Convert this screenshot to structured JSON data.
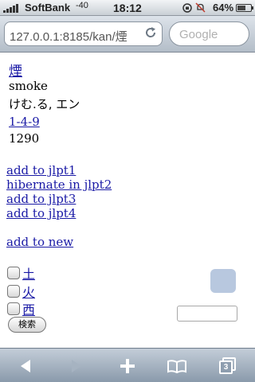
{
  "status_bar": {
    "carrier": "SoftBank",
    "rssi": "-40",
    "time": "18:12",
    "battery_percent": "64%",
    "battery_level": 0.64,
    "icons": [
      "signal-bars-icon",
      "lock-rotation-icon",
      "alarm-off-icon"
    ]
  },
  "address_bar": {
    "url": "127.0.0.1:8185/kan/煙",
    "search_placeholder": "Google"
  },
  "kanji": {
    "character": "煙",
    "meaning": "smoke",
    "readings": "けむ.る, エン",
    "code": "1-4-9",
    "number": "1290"
  },
  "actions": [
    "add to jlpt1",
    "hibernate in jlpt2",
    "add to jlpt3",
    "add to jlpt4"
  ],
  "add_to_new": "add to new",
  "radicals": [
    "土",
    "火",
    "西"
  ],
  "search_button": "検索",
  "toolbar": {
    "tabs_count": "3",
    "icons": [
      "back-icon",
      "forward-icon",
      "add-icon",
      "bookmarks-icon",
      "pages-icon"
    ]
  },
  "colors": {
    "link": "#1a1aa6",
    "toolbar": "#8a9aab",
    "widget": "#b8c8df"
  }
}
